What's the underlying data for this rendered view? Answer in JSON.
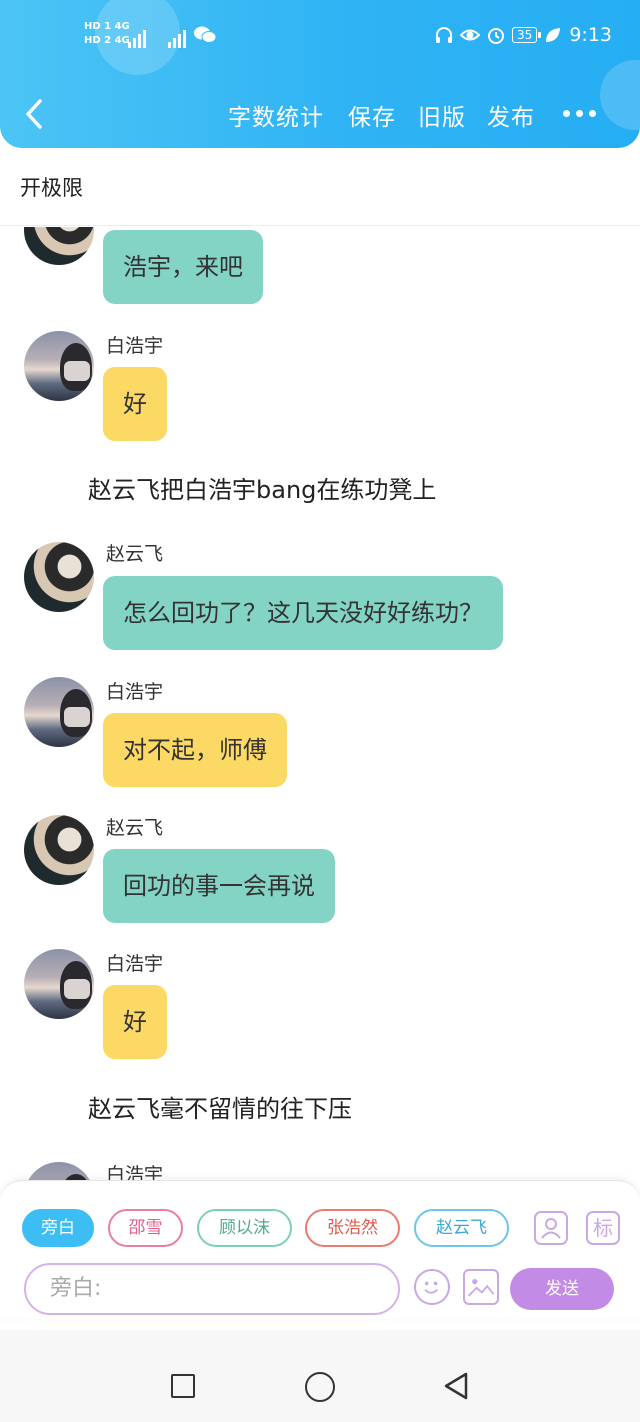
{
  "status_bar": {
    "network_top": "HD 1 4G",
    "network_bottom": "HD 2 4G",
    "battery": "35",
    "time": "9:13",
    "icons": [
      "headphones-icon",
      "eye-icon",
      "alarm-icon",
      "battery-icon",
      "leaf-icon"
    ]
  },
  "toolbar": {
    "back_icon": "chevron-left-icon",
    "word_count_label": "字数统计",
    "save_label": "保存",
    "old_version_label": "旧版",
    "publish_label": "发布",
    "more_icon": "more-dots-icon"
  },
  "story": {
    "title": "开极限"
  },
  "messages": [
    {
      "type": "bubble",
      "sender": "",
      "text": "浩宇，来吧",
      "color": "teal",
      "avatar": "zhao"
    },
    {
      "type": "bubble",
      "sender": "白浩宇",
      "text": "好",
      "color": "yellow",
      "avatar": "bai"
    },
    {
      "type": "narration",
      "text": "赵云飞把白浩宇bang在练功凳上"
    },
    {
      "type": "bubble",
      "sender": "赵云飞",
      "text": "怎么回功了？这几天没好好练功？",
      "color": "teal",
      "avatar": "zhao"
    },
    {
      "type": "bubble",
      "sender": "白浩宇",
      "text": "对不起，师傅",
      "color": "yellow",
      "avatar": "bai"
    },
    {
      "type": "bubble",
      "sender": "赵云飞",
      "text": "回功的事一会再说",
      "color": "teal",
      "avatar": "zhao"
    },
    {
      "type": "bubble",
      "sender": "白浩宇",
      "text": "好",
      "color": "yellow",
      "avatar": "bai"
    },
    {
      "type": "narration",
      "text": "赵云飞毫不留情的往下压"
    },
    {
      "type": "bubble",
      "sender": "白浩宇",
      "text": "",
      "color": "",
      "avatar": "bai"
    }
  ],
  "characters": {
    "narrator": "旁白",
    "c1": "邵雪",
    "c2": "顾以沫",
    "c3": "张浩然",
    "c4": "赵云飞"
  },
  "side_icons": {
    "contact": "person-card-icon",
    "tag": "标"
  },
  "input": {
    "placeholder": "旁白:",
    "emoji_icon": "smiley-icon",
    "image_icon": "image-icon",
    "send_label": "发送"
  },
  "navbar": {
    "icons": [
      "recent-apps-icon",
      "home-icon",
      "back-triangle-icon"
    ]
  },
  "colors": {
    "header": "#2fb3f4",
    "teal_bubble": "#84d4c6",
    "yellow_bubble": "#fbd964",
    "accent_purple": "#c18be6"
  }
}
